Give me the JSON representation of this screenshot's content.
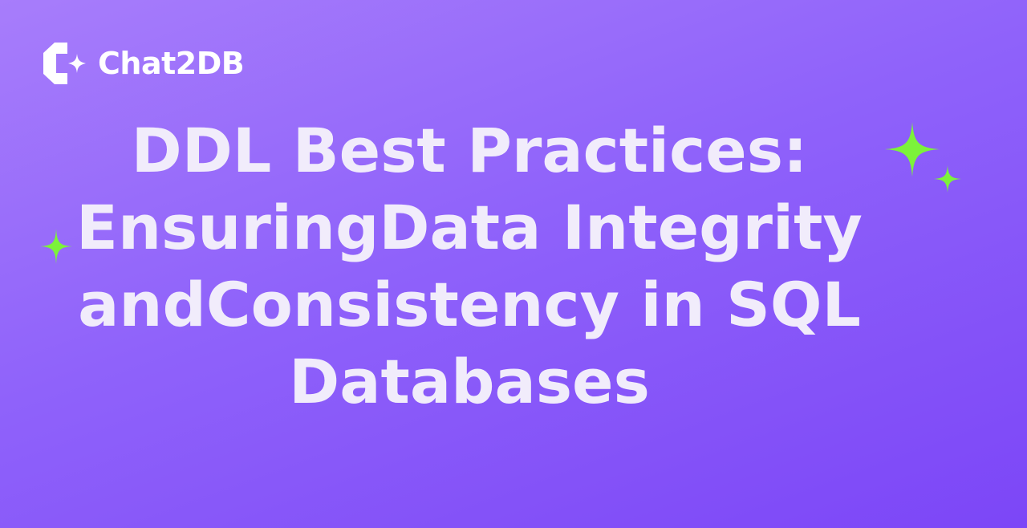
{
  "brand": {
    "name": "Chat2DB",
    "logo_icon": "chat2db-logo-icon"
  },
  "title": {
    "line1": "DDL Best Practices:",
    "line2": "EnsuringData Integrity",
    "line3": "andConsistency in SQL",
    "line4": "Databases"
  },
  "colors": {
    "background_start": "#a77dfb",
    "background_end": "#7c46f7",
    "title_text": "#f1ecfb",
    "sparkle": "#7cf33a"
  },
  "decorations": [
    "sparkle-icon",
    "sparkle-icon",
    "sparkle-icon"
  ]
}
